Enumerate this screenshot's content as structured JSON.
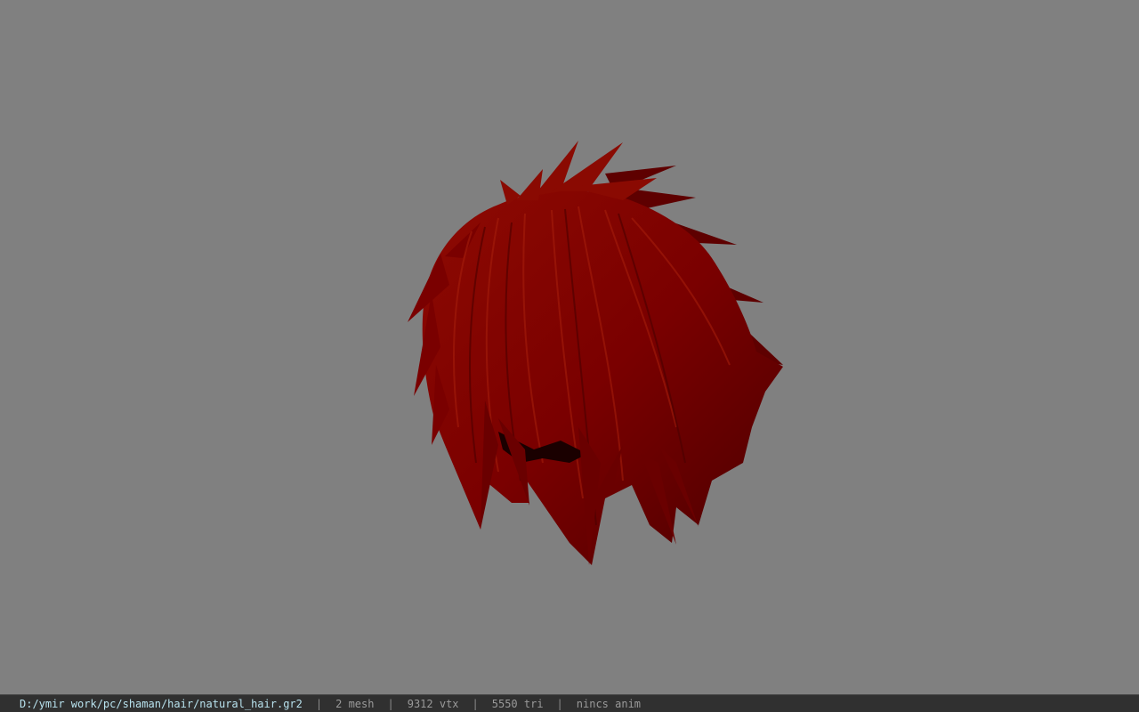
{
  "viewport": {
    "background_color": "#808080",
    "model_name": "hair-model",
    "hair_color": "#7a0000",
    "hair_highlight": "#a01208",
    "hair_shadow": "#3a0000"
  },
  "status_bar": {
    "file_path": "D:/ymir work/pc/shaman/hair/natural_hair.gr2",
    "separator": "|",
    "mesh_count": "2 mesh",
    "vertex_count": "9312 vtx",
    "triangle_count": "5550 tri",
    "animation": "nincs anim",
    "path_color": "#b8e2ee"
  }
}
